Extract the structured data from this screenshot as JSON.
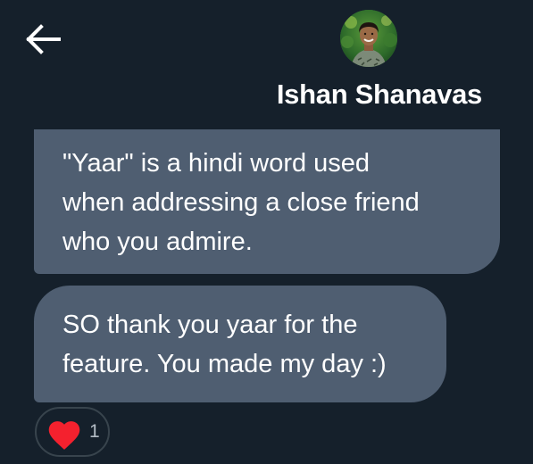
{
  "header": {
    "contact_name": "Ishan Shanavas",
    "back_icon": "arrow-left-icon",
    "avatar_icon": "profile-photo"
  },
  "messages": [
    {
      "lines": [
        "\"Yaar\" is a hindi word used",
        "when addressing a close friend",
        "who you admire."
      ]
    },
    {
      "lines": [
        "SO thank you yaar for the",
        "feature. You made my day :)"
      ]
    }
  ],
  "reaction": {
    "icon": "heart-icon",
    "count": "1"
  },
  "colors": {
    "background": "#15202b",
    "bubble": "#4f5e71",
    "heart": "#f4212e",
    "text": "#ffffff",
    "reaction_border": "#38444d"
  }
}
